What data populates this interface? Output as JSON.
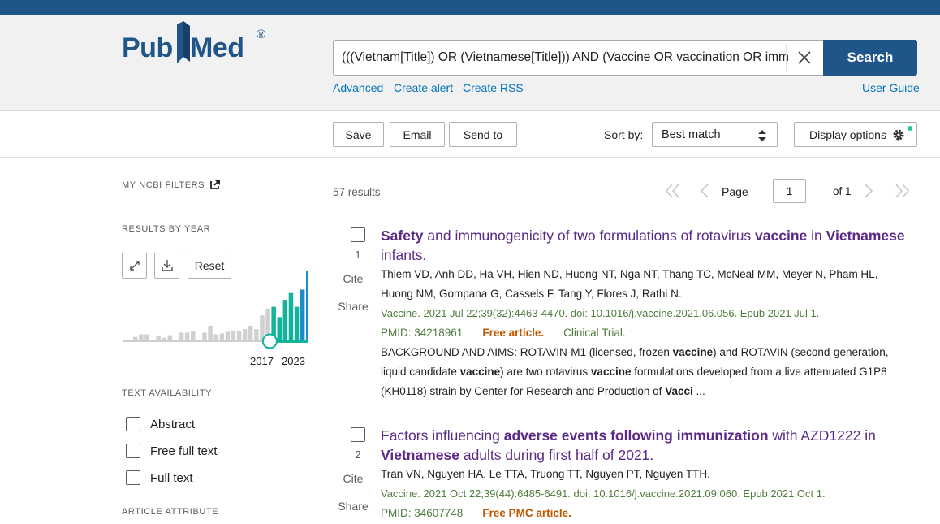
{
  "logo": {
    "part1": "Pub",
    "part2": "Med",
    "registered": "®"
  },
  "search": {
    "query": "(((Vietnam[Title]) OR (Vietnamese[Title])) AND (Vaccine OR vaccination OR immunization",
    "button_label": "Search"
  },
  "header_links": {
    "advanced": "Advanced",
    "create_alert": "Create alert",
    "create_rss": "Create RSS",
    "user_guide": "User Guide"
  },
  "toolbar": {
    "save": "Save",
    "email": "Email",
    "send_to": "Send to",
    "sort_label": "Sort by:",
    "sort_value": "Best match",
    "display_options": "Display options"
  },
  "sidebar": {
    "ncbi_filters": "MY NCBI FILTERS",
    "results_by_year": "RESULTS BY YEAR",
    "reset": "Reset",
    "year_start": "2017",
    "year_end": "2023",
    "histogram_levels": [
      0.05,
      0.08,
      0.08,
      0.0,
      0.06,
      0.04,
      0.07,
      0.0,
      0.1,
      0.1,
      0.12,
      0.0,
      0.1,
      0.18,
      0.08,
      0.09,
      0.11,
      0.12,
      0.12,
      0.14,
      0.18,
      0.14,
      0.3,
      0.38,
      0.4,
      0.28,
      0.48,
      0.56,
      0.4,
      0.6,
      0.82,
      0.68
    ],
    "histogram_selected_from_index": 24,
    "text_availability": "TEXT AVAILABILITY",
    "filters": [
      "Abstract",
      "Free full text",
      "Full text"
    ],
    "article_attribute": "ARTICLE ATTRIBUTE"
  },
  "pager": {
    "results_count": "57 results",
    "page_label": "Page",
    "page_value": "1",
    "of_label": "of 1"
  },
  "results": [
    {
      "number": "1",
      "cite": "Cite",
      "share": "Share",
      "authors": "Thiem VD, Anh DD, Ha VH, Hien ND, Huong NT, Nga NT, Thang TC, McNeal MM, Meyer N, Pham HL, Huong NM, Gompana G, Cassels F, Tang Y, Flores J, Rathi N.",
      "citation": "Vaccine. 2021 Jul 22;39(32):4463-4470. doi: 10.1016/j.vaccine.2021.06.056. Epub 2021 Jul 1.",
      "pmid": "PMID: 34218961",
      "free_label": "Free article.",
      "pub_type": "Clinical Trial."
    },
    {
      "number": "2",
      "cite": "Cite",
      "share": "Share",
      "authors": "Tran VN, Nguyen HA, Le TTA, Truong TT, Nguyen PT, Nguyen TTH.",
      "citation": "Vaccine. 2021 Oct 22;39(44):6485-6491. doi: 10.1016/j.vaccine.2021.09.060. Epub 2021 Oct 1.",
      "pmid": "PMID: 34607748",
      "free_label": "Free PMC article."
    }
  ],
  "result1_title_parts": [
    "Safety",
    " and immunogenicity of two formulations of rotavirus ",
    "vaccine",
    " in ",
    "Vietnamese",
    " infants."
  ],
  "result1_snippet_parts": [
    "BACKGROUND AND AIMS: ROTAVIN-M1 (licensed, frozen ",
    "vaccine",
    ") and ROTAVIN (second-generation, liquid candidate ",
    "vaccine",
    ") are two rotavirus ",
    "vaccine",
    " formulations developed from a live attenuated G1P8 (KH0118) strain by Center for Research and Production of ",
    "Vacci",
    " ..."
  ],
  "result2_title_parts": [
    "Factors influencing ",
    "adverse events following immunization",
    " with AZD1222 in ",
    "Vietnamese",
    " adults during first half of 2021."
  ],
  "colors": {
    "brand": "#20558a",
    "link": "#0071bc",
    "title": "#5b2a86",
    "citation": "#4f7d3e",
    "free": "#c05600",
    "histogram": "#1a8ec9",
    "histogram_selected": "#12b39a",
    "histogram_gray": "#d0d0d0"
  },
  "icons": [
    "close-icon",
    "sort-arrows-icon",
    "gear-icon",
    "external-link-icon",
    "expand-icon",
    "download-icon",
    "first-page-icon",
    "prev-page-icon",
    "next-page-icon",
    "last-page-icon"
  ]
}
